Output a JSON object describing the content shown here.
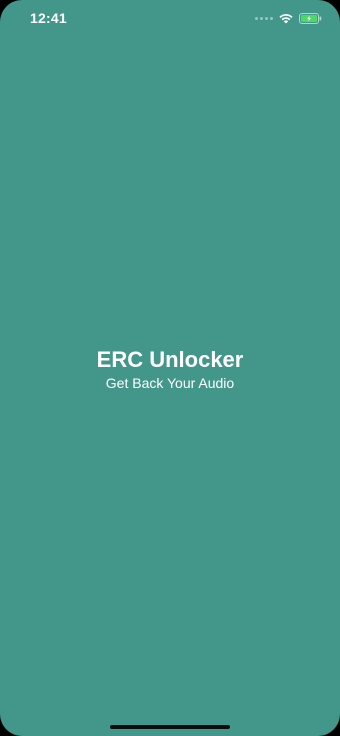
{
  "status_bar": {
    "time": "12:41",
    "icons": [
      "signal-dots-icon",
      "wifi-icon",
      "battery-charging-icon"
    ]
  },
  "splash": {
    "title": "ERC Unlocker",
    "subtitle": "Get Back Your Audio"
  },
  "colors": {
    "background": "#43978a",
    "text": "#ffffff",
    "battery_fill": "#4cd964"
  }
}
